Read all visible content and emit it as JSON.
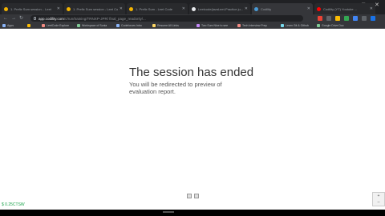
{
  "browser": {
    "tabs": [
      {
        "title": "1. Prefix Sum session... Leet",
        "favicon_color": "#f4b400",
        "active": false
      },
      {
        "title": "1. Prefix Sum session - Leet Co",
        "favicon_color": "#f4b400",
        "active": false
      },
      {
        "title": "1. Prefix Sum - Leet Code",
        "favicon_color": "#f4b400",
        "active": false
      },
      {
        "title": "Leetcode/javaLeet-Practice ju...",
        "favicon_color": "#e8eaed",
        "active": false
      },
      {
        "title": "Codility",
        "favicon_color": "#4a9bd6",
        "active": true
      },
      {
        "title": "Codility (YT) Youtube ...",
        "favicon_color": "#ff0000",
        "active": false
      }
    ],
    "new_tab": "+",
    "window_controls": [
      "–",
      "□",
      "✕"
    ],
    "nav": {
      "back": "←",
      "forward": "→",
      "reload": "↻"
    },
    "address": {
      "host": "app.codility.com",
      "path": "/c/run/training/TRNXP-JPR/ final_page_readonly/..."
    },
    "extension_colors": [
      "#ea4335",
      "#5f6368",
      "#fbbc04",
      "#34a853",
      "#4285f4",
      "#5f6368",
      "#1a73e8"
    ],
    "bookmarks": [
      {
        "label": "Apps",
        "color": "#8ab4f8"
      },
      {
        "label": "",
        "color": "#fbbc04"
      },
      {
        "label": "LeetCode Explore",
        "color": "#f28b82"
      },
      {
        "label": "Workspace of Sonia",
        "color": "#81c995"
      },
      {
        "label": "Codeforces Intro",
        "color": "#8ab4f8"
      },
      {
        "label": "Resume All Links",
        "color": "#fdd663"
      },
      {
        "label": "Two Sum Nice to see",
        "color": "#c58af9"
      },
      {
        "label": "Tech Interview Prep",
        "color": "#f28b82"
      },
      {
        "label": "Learn Git & Github",
        "color": "#78d9ec"
      },
      {
        "label": "Google Drive Doc",
        "color": "#81c995"
      }
    ]
  },
  "page": {
    "title": "The session has ended",
    "message": "You will be redirected to preview of evaluation report.",
    "ticker": "$ 0.25CTSW",
    "zoom": {
      "in": "+",
      "out": "–"
    }
  }
}
